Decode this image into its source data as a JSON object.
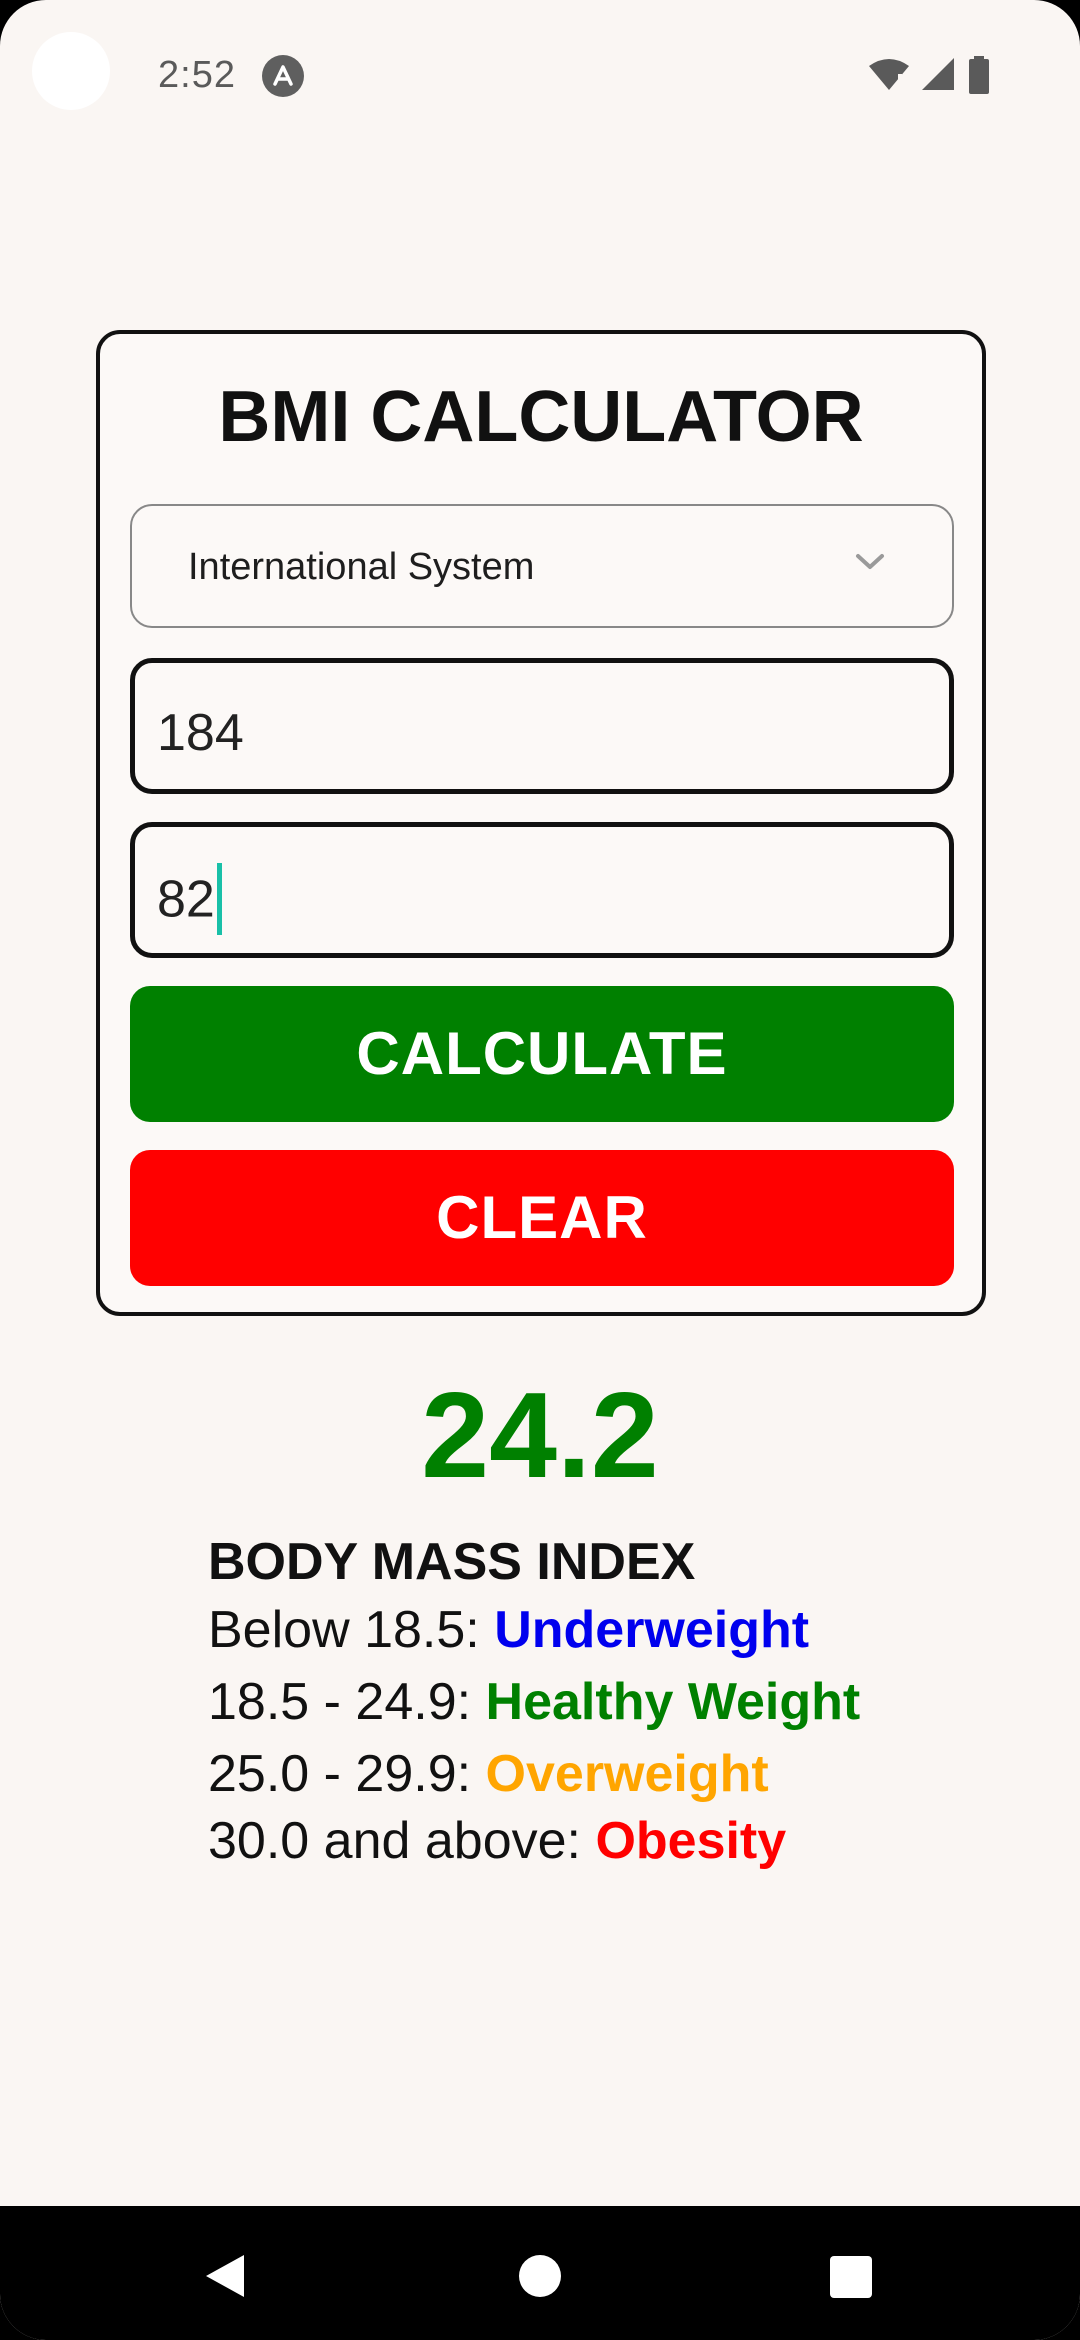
{
  "status_bar": {
    "time": "2:52",
    "notification_icon": "app-notification-icon",
    "icons": [
      "wifi-icon",
      "signal-icon",
      "battery-icon"
    ]
  },
  "card": {
    "title": "BMI CALCULATOR",
    "unit_select": {
      "selected": "International System",
      "icon": "chevron-down-icon"
    },
    "height_input": {
      "value": "184"
    },
    "weight_input": {
      "value": "82"
    },
    "calculate_label": "CALCULATE",
    "clear_label": "CLEAR"
  },
  "result": {
    "bmi": "24.2"
  },
  "legend": {
    "heading": "BODY MASS INDEX",
    "rows": [
      {
        "range": "Below 18.5: ",
        "category": "Underweight"
      },
      {
        "range": "18.5 - 24.9: ",
        "category": "Healthy Weight"
      },
      {
        "range": "25.0 - 29.9: ",
        "category": "Overweight"
      },
      {
        "range": "30.0 and above: ",
        "category": "Obesity"
      }
    ]
  },
  "colors": {
    "calculate": "#008000",
    "clear": "#ff0000",
    "underweight": "#0000ee",
    "healthy": "#008000",
    "overweight": "#ffa500",
    "obesity": "#ff0000"
  },
  "nav_bar": {
    "icons": [
      "back-icon",
      "home-icon",
      "recents-icon"
    ]
  }
}
